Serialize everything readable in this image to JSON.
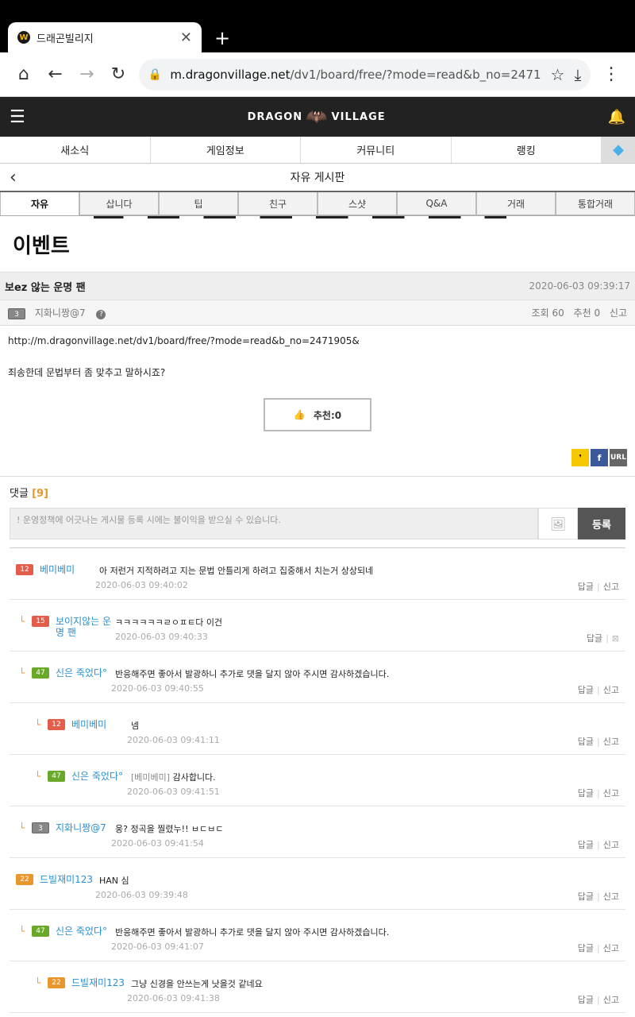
{
  "browser": {
    "tab_title": "드래곤빌리지",
    "url_domain": "m.dragonvillage.net",
    "url_path": "/dv1/board/free/?mode=read&b_no=2471"
  },
  "site": {
    "logo_left": "DRAGON",
    "logo_right": "VILLAGE",
    "nav": [
      "새소식",
      "게임정보",
      "커뮤니티",
      "랭킹"
    ],
    "board_title": "자유 게시판",
    "subtabs": [
      "자유",
      "삽니다",
      "팁",
      "친구",
      "스샷",
      "Q&A",
      "거래",
      "통합거래"
    ],
    "banner_text": "이벤트"
  },
  "post": {
    "title": "보ez 않는 운명 팬",
    "date": "2020-06-03 09:39:17",
    "author_level": "3",
    "author": "지화니짱@7",
    "views": "조회 60",
    "likes": "추천 0",
    "report": "신고",
    "body_link": "http://m.dragonvillage.net/dv1/board/free/?mode=read&b_no=2471905&",
    "body_text": "죄송한데 문법부터 좀 맞추고 말하시죠?",
    "recommend_label": "추천:0"
  },
  "comments_section": {
    "label": "댓글",
    "count": "[9]",
    "placeholder": "! 운영정책에 어긋나는 게시물 등록 시에는 불이익을 받으실 수 있습니다.",
    "submit_label": "등록",
    "reply_label": "답글",
    "report_label": "신고"
  },
  "comments": [
    {
      "level": "12",
      "name": "베미베미",
      "text": "아 저런거 지적하려고 지는 문법 안틀리게 하려고 집중해서 치는거 상상되네",
      "time": "2020-06-03 09:40:02"
    },
    {
      "level": "15",
      "name": "보이지않는 운명 팬",
      "text": "ㅋㅋㅋㅋㅋㅋㄹㅇㅍㅌ다 이건",
      "time": "2020-06-03 09:40:33"
    },
    {
      "level": "47",
      "name": "신은 죽었다°",
      "text": "반응해주면 좋아서 발광하니 추가로 댓을 달지 않아 주시면 감사하겠습니다.",
      "time": "2020-06-03 09:40:55"
    },
    {
      "level": "12",
      "name": "베미베미",
      "text": "넴",
      "time": "2020-06-03 09:41:11"
    },
    {
      "level": "47",
      "name": "신은 죽었다°",
      "mention": "[베미베미]",
      "text": "감사합니다.",
      "time": "2020-06-03 09:41:51"
    },
    {
      "level": "3",
      "name": "지화니짱@7",
      "text": "웅? 정곡을 찔렸누!! ㅂㄷㅂㄷ",
      "time": "2020-06-03 09:41:54"
    },
    {
      "level": "22",
      "name": "드빌재미123",
      "text": "HAN 심",
      "time": "2020-06-03 09:39:48"
    },
    {
      "level": "47",
      "name": "신은 죽었다°",
      "text": "반응해주면 좋아서 발광하니 추가로 댓을 달지 않아 주시면 감사하겠습니다.",
      "time": "2020-06-03 09:41:07"
    },
    {
      "level": "22",
      "name": "드빌재미123",
      "text": "그냥 신경을 안쓰는게 낫을것 같네요",
      "time": "2020-06-03 09:41:38"
    }
  ]
}
